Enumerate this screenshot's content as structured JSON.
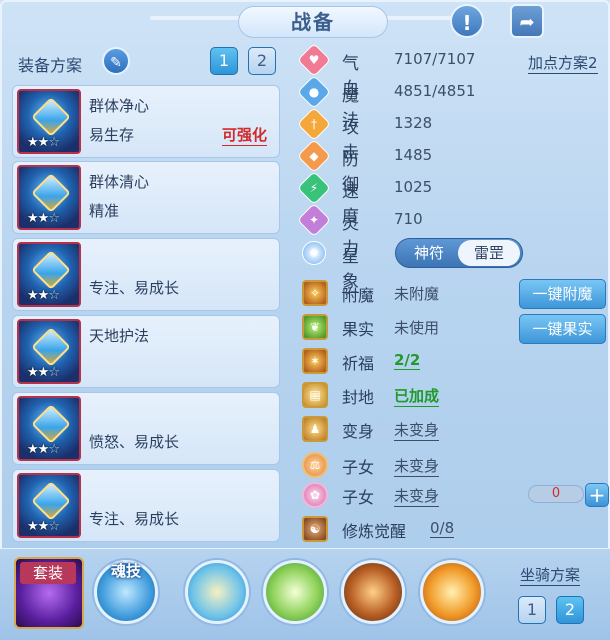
{
  "title": "战备",
  "top_icons": {
    "info": "exclamation-icon",
    "share": "share-icon"
  },
  "loadout": {
    "label": "装备方案",
    "tabs": [
      "1",
      "2"
    ]
  },
  "equipment": [
    {
      "name": "群体净心",
      "trait": "易生存",
      "tag": "可强化",
      "stars_filled": 2,
      "stars_total": 3
    },
    {
      "name": "群体清心",
      "trait": "精准",
      "tag": "",
      "stars_filled": 2,
      "stars_total": 3
    },
    {
      "name": "",
      "trait": "专注、易成长",
      "tag": "",
      "stars_filled": 2,
      "stars_total": 3
    },
    {
      "name": "天地护法",
      "trait": "",
      "tag": "",
      "stars_filled": 2,
      "stars_total": 3
    },
    {
      "name": "",
      "trait": "愤怒、易成长",
      "tag": "",
      "stars_filled": 2,
      "stars_total": 3
    },
    {
      "name": "",
      "trait": "专注、易成长",
      "tag": "",
      "stars_filled": 2,
      "stars_total": 3
    }
  ],
  "attributes": {
    "plan_link": "加点方案2",
    "items": [
      {
        "label": "气血",
        "value": "7107/7107",
        "color": "#f17b95",
        "icon": "heart-icon"
      },
      {
        "label": "魔法",
        "value": "4851/4851",
        "color": "#5aa8ea",
        "icon": "mana-icon"
      },
      {
        "label": "攻击",
        "value": "1328",
        "color": "#f5a83a",
        "icon": "sword-icon"
      },
      {
        "label": "防御",
        "value": "1485",
        "color": "#f39a4d",
        "icon": "shield-icon"
      },
      {
        "label": "速度",
        "value": "1025",
        "color": "#39c27a",
        "icon": "speed-icon"
      },
      {
        "label": "灵力",
        "value": "710",
        "color": "#c27ed9",
        "icon": "spirit-icon"
      }
    ]
  },
  "star_sign": {
    "label": "星象",
    "options": [
      "神符",
      "雷罡"
    ],
    "selected": "雷罡"
  },
  "states": [
    {
      "label": "附魔",
      "value": "未附魔",
      "style": "plain"
    },
    {
      "label": "果实",
      "value": "未使用",
      "style": "plain"
    },
    {
      "label": "祈福",
      "value": "2/2",
      "style": "green"
    },
    {
      "label": "封地",
      "value": "已加成",
      "style": "green"
    },
    {
      "label": "变身",
      "value": "未变身",
      "style": "ul"
    },
    {
      "label": "子女",
      "value": "未变身",
      "style": "ul"
    },
    {
      "label": "子女",
      "value": "未变身",
      "style": "ul"
    },
    {
      "label": "修炼觉醒",
      "value": "0/8",
      "style": "ul"
    }
  ],
  "buttons": {
    "enchant": "一键附魔",
    "fruit": "一键果实"
  },
  "counter": {
    "value": "0",
    "plus": "+"
  },
  "bottom": {
    "suit_label": "套装",
    "soul_skill_label": "魂技",
    "mount_label": "坐骑方案",
    "mount_tabs": [
      "1",
      "2"
    ]
  }
}
